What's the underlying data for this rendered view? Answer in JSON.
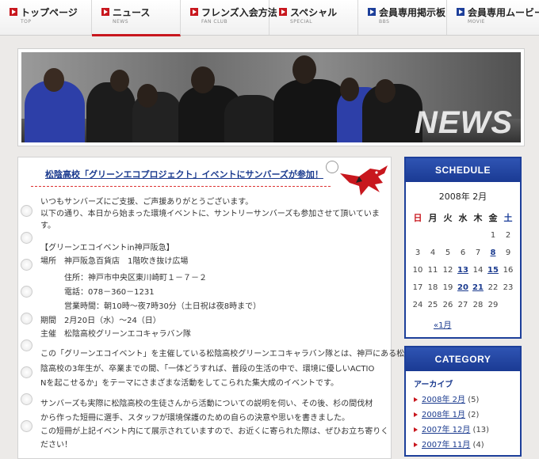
{
  "nav": [
    {
      "label": "トップページ",
      "sub": "TOP"
    },
    {
      "label": "ニュース",
      "sub": "NEWS"
    },
    {
      "label": "フレンズ入会方法",
      "sub": "FAN CLUB"
    },
    {
      "label": "スペシャル",
      "sub": "SPECIAL"
    },
    {
      "label": "会員専用掲示板",
      "sub": "BBS"
    },
    {
      "label": "会員専用ムービー",
      "sub": "MOVIE"
    }
  ],
  "banner": {
    "title": "NEWS"
  },
  "article": {
    "title": "松陰高校「グリーンエコプロジェクト」イベントにサンバーズが参加！",
    "lines": [
      "いつもサンバーズにご支援、ご声援ありがとうございます。",
      "以下の通り、本日から始まった環境イベントに、サントリーサンバーズも参加させて頂いていま",
      "す。",
      "【グリーンエコイベントin神戸阪急】",
      "場所　神戸阪急百貨店　1階吹き抜け広場",
      "　　　住所：神戸市中央区東川崎町１－７－２",
      "　　　電話：078－360－1231",
      "　　　営業時間：朝10時～夜7時30分（土日祝は夜8時まで）",
      "期間　2月20日（水）～24（日）",
      "主催　松陰高校グリーンエコキャラバン隊",
      "この「グリーンエコイベント」を主催している松陰高校グリーンエコキャラバン隊とは、神戸にある松",
      "陰高校の3年生が、卒業までの間、「一体どうすれば、普段の生活の中で、環境に優しいACTIO",
      "Nを起こせるか」をテーマにさまざまな活動をしてこられた集大成のイベントです。",
      "サンバーズも実際に松陰高校の生徒さんから活動についての説明を伺い、その後、杉の間伐材",
      "から作った短冊に選手、スタッフが環境保護のための自らの決意や思いを書きました。",
      "この短冊が上記イベント内にて展示されていますので、お近くに寄られた際は、ぜひお立ち寄りく",
      "ださい！"
    ]
  },
  "schedule": {
    "heading": "SCHEDULE",
    "month": "2008年 2月",
    "weekdays": [
      "日",
      "月",
      "火",
      "水",
      "木",
      "金",
      "土"
    ],
    "weeks": [
      [
        "",
        "",
        "",
        "",
        "",
        "1",
        "2"
      ],
      [
        "3",
        "4",
        "5",
        "6",
        "7",
        "8",
        "9"
      ],
      [
        "10",
        "11",
        "12",
        "13",
        "14",
        "15",
        "16"
      ],
      [
        "17",
        "18",
        "19",
        "20",
        "21",
        "22",
        "23"
      ],
      [
        "24",
        "25",
        "26",
        "27",
        "28",
        "29",
        ""
      ]
    ],
    "prev": "«1月"
  },
  "category": {
    "heading": "CATEGORY",
    "subheading": "アーカイブ",
    "archives": [
      {
        "label": "2008年 2月",
        "count": "(5)"
      },
      {
        "label": "2008年 1月",
        "count": "(2)"
      },
      {
        "label": "2007年 12月",
        "count": "(13)"
      },
      {
        "label": "2007年 11月",
        "count": "(4)"
      }
    ]
  },
  "colors": {
    "accent": "#c8171e",
    "brand": "#1d3f9a",
    "link": "#1b3b8f"
  }
}
